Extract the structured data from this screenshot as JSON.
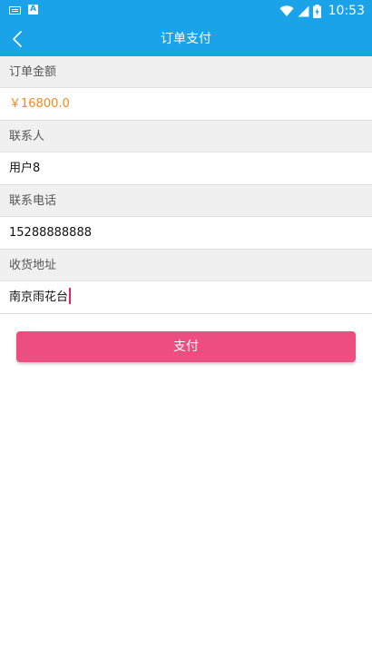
{
  "status_bar": {
    "time": "10:53",
    "a_icon_text": "A",
    "icons": [
      "keyboard-icon",
      "a-icon",
      "wifi-icon",
      "signal-icon",
      "battery-charging-icon"
    ]
  },
  "toolbar": {
    "title": "订单支付",
    "back_icon": "back-icon"
  },
  "form": {
    "order_amount_label": "订单金额",
    "order_amount_value": "￥16800.0",
    "contact_label": "联系人",
    "contact_value": "用户8",
    "phone_label": "联系电话",
    "phone_value": "15288888888",
    "address_label": "收货地址",
    "address_value": "南京雨花台"
  },
  "pay_button_label": "支付",
  "colors": {
    "primary": "#1aa3e8",
    "amount": "#f08a1c",
    "button": "#ec4f7f",
    "caret": "#e91e63",
    "section_bg": "#f0f0f0"
  }
}
